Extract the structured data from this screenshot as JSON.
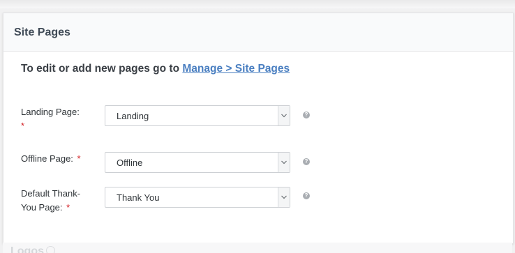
{
  "section": {
    "title": "Site Pages"
  },
  "instruction": {
    "prefix": "To edit or add new pages go to ",
    "link_text": "Manage > Site Pages"
  },
  "fields": [
    {
      "label_line1": "Landing Page:",
      "label_line2": "",
      "required_mark": "*",
      "value": "Landing",
      "help_icon": "?"
    },
    {
      "label_line1": "Offline Page:",
      "label_line2": "",
      "required_mark": "*",
      "value": "Offline",
      "help_icon": "?"
    },
    {
      "label_line1": "Default Thank-",
      "label_line2": "You Page:",
      "required_mark": "*",
      "value": "Thank You",
      "help_icon": "?"
    }
  ],
  "next_section": {
    "title": "Logos"
  },
  "colors": {
    "link": "#4a7fc1",
    "required": "#d4252a",
    "title": "#3f4a56"
  },
  "icons": {
    "select_arrow": "chevron-down-icon",
    "help": "question-circle-icon"
  }
}
